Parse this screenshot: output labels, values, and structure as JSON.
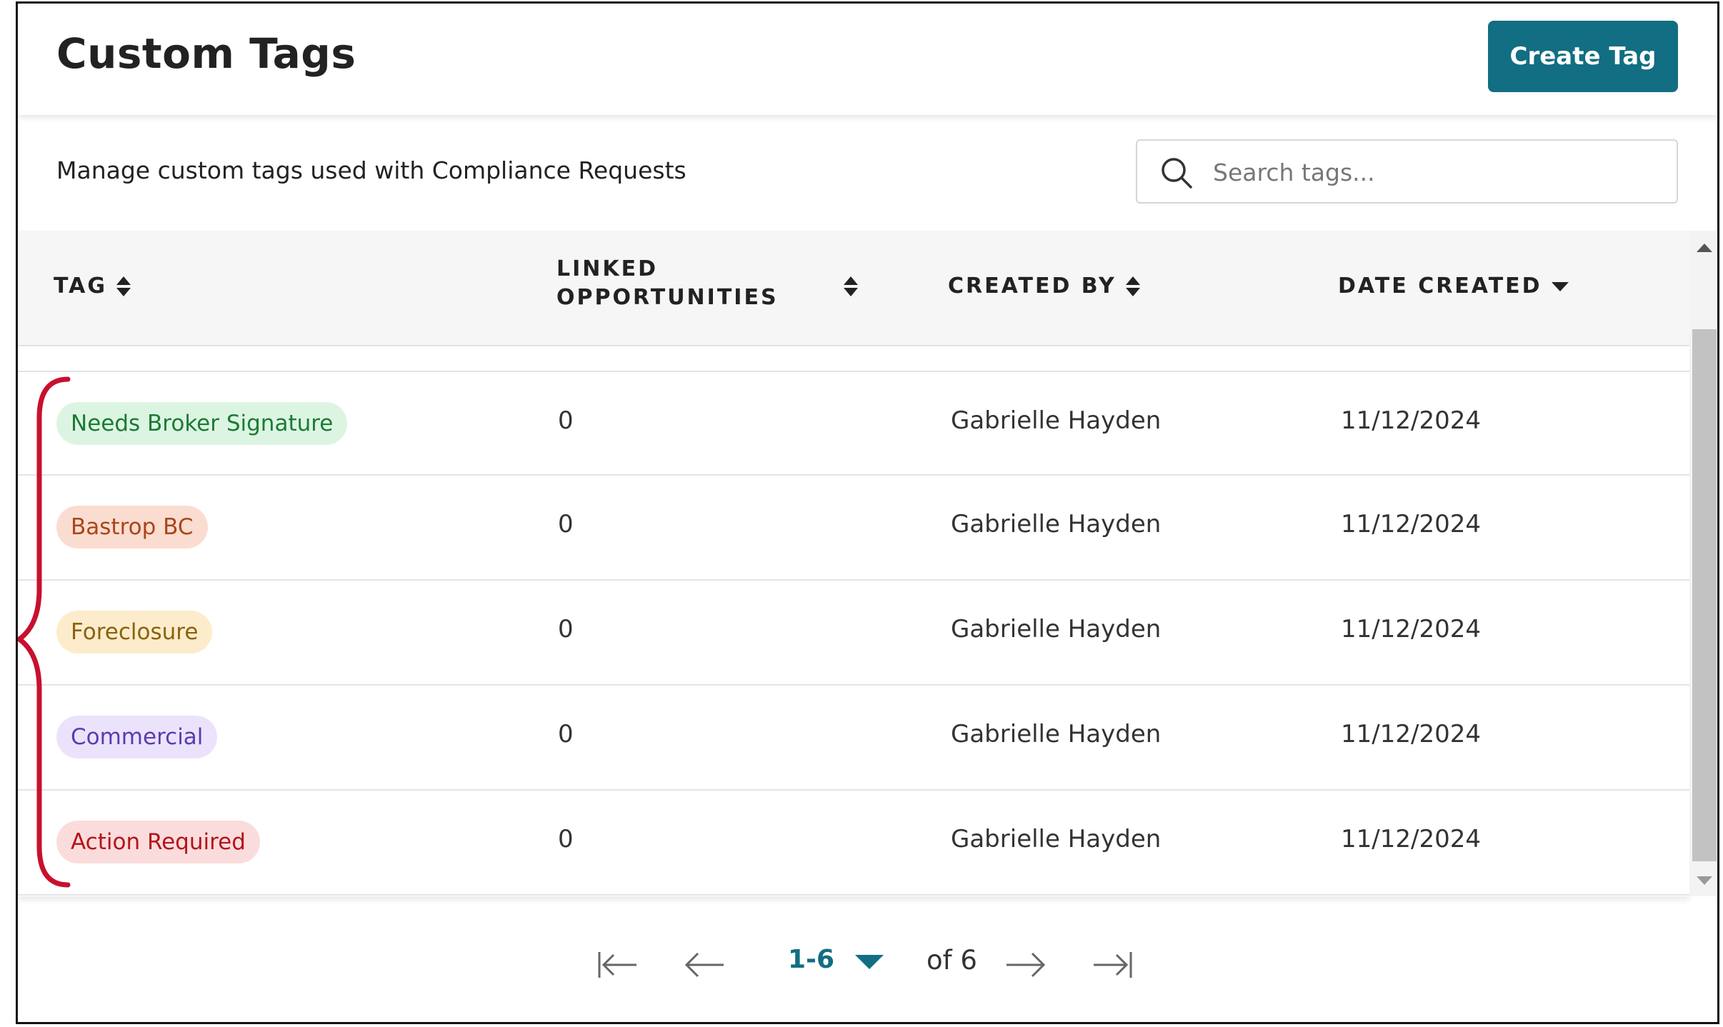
{
  "header": {
    "title": "Custom Tags",
    "create_button_label": "Create Tag",
    "accent_color": "#126e82"
  },
  "subheader": {
    "description": "Manage custom tags used with Compliance Requests",
    "search_placeholder": "Search tags..."
  },
  "table": {
    "columns": {
      "tag": "TAG",
      "linked_line1": "LINKED",
      "linked_line2": "OPPORTUNITIES",
      "created_by": "CREATED BY",
      "date_created": "DATE CREATED"
    },
    "sort": {
      "column": "date_created",
      "direction": "descending"
    },
    "rows": [
      {
        "tag": "Needs Broker Signature",
        "tag_bg": "#dcf5e2",
        "tag_fg": "#1c7a35",
        "linked": "0",
        "created_by": "Gabrielle Hayden",
        "date_created": "11/12/2024"
      },
      {
        "tag": "Bastrop BC",
        "tag_bg": "#fbdcd0",
        "tag_fg": "#a8471a",
        "linked": "0",
        "created_by": "Gabrielle Hayden",
        "date_created": "11/12/2024"
      },
      {
        "tag": "Foreclosure",
        "tag_bg": "#fdeccb",
        "tag_fg": "#8a6210",
        "linked": "0",
        "created_by": "Gabrielle Hayden",
        "date_created": "11/12/2024"
      },
      {
        "tag": "Commercial",
        "tag_bg": "#ebe3fb",
        "tag_fg": "#5b3bb0",
        "linked": "0",
        "created_by": "Gabrielle Hayden",
        "date_created": "11/12/2024"
      },
      {
        "tag": "Action Required",
        "tag_bg": "#fbdcdc",
        "tag_fg": "#b3141c",
        "linked": "0",
        "created_by": "Gabrielle Hayden",
        "date_created": "11/12/2024"
      }
    ]
  },
  "pagination": {
    "range": "1-6",
    "total": "of 6"
  },
  "annotation": {
    "brace_color": "#c8102e"
  },
  "icons": {
    "search": "search-icon",
    "sort": "sort-icon",
    "sort_desc": "sort-desc-icon",
    "first": "first-page-icon",
    "prev": "prev-page-icon",
    "next": "next-page-icon",
    "last": "last-page-icon"
  }
}
